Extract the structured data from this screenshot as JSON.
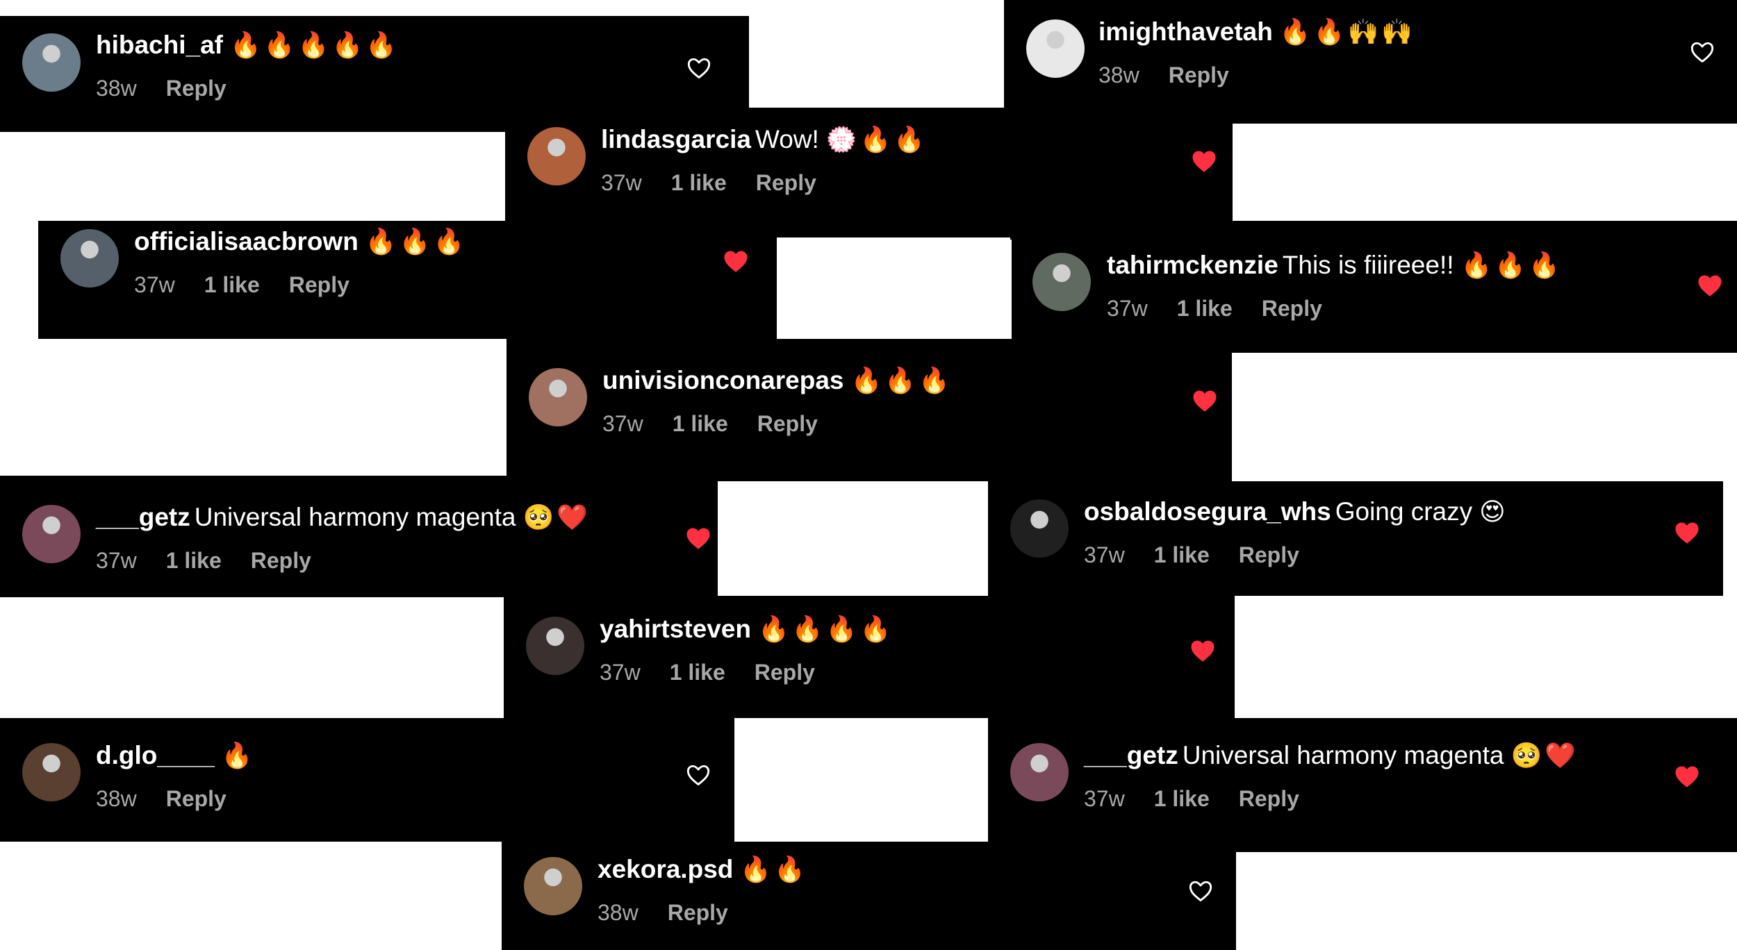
{
  "accent": "#ff3040",
  "comments": [
    {
      "user": "hibachi_af",
      "text": "",
      "emojis": "🔥🔥🔥🔥🔥",
      "age": "38w",
      "likes": "",
      "reply": "Reply",
      "liked": false,
      "avatar": "#6b7d8a"
    },
    {
      "user": "lindasgarcia",
      "text": "Wow!",
      "emojis": "💮🔥🔥",
      "age": "37w",
      "likes": "1 like",
      "reply": "Reply",
      "liked": true,
      "avatar": "#b0603a"
    },
    {
      "user": "officialisaacbrown",
      "text": "",
      "emojis": "🔥🔥🔥",
      "age": "37w",
      "likes": "1 like",
      "reply": "Reply",
      "liked": true,
      "avatar": "#56606a"
    },
    {
      "user": "univisionconarepas",
      "text": "",
      "emojis": "🔥🔥🔥",
      "age": "37w",
      "likes": "1 like",
      "reply": "Reply",
      "liked": true,
      "avatar": "#a07060"
    },
    {
      "user": "___getz",
      "text": "Universal harmony magenta",
      "emojis": "🥺❤️",
      "age": "37w",
      "likes": "1 like",
      "reply": "Reply",
      "liked": true,
      "avatar": "#7a4a5a"
    },
    {
      "user": "yahirtsteven",
      "text": "",
      "emojis": "🔥🔥🔥🔥",
      "age": "37w",
      "likes": "1 like",
      "reply": "Reply",
      "liked": true,
      "avatar": "#3a3030"
    },
    {
      "user": "d.glo____",
      "text": "",
      "emojis": "🔥",
      "age": "38w",
      "likes": "",
      "reply": "Reply",
      "liked": false,
      "avatar": "#5a4030"
    },
    {
      "user": "xekora.psd",
      "text": "",
      "emojis": "🔥🔥",
      "age": "38w",
      "likes": "",
      "reply": "Reply",
      "liked": false,
      "avatar": "#8a6a4a"
    },
    {
      "user": "imighthavetah",
      "text": "",
      "emojis": "🔥🔥🙌🙌",
      "age": "38w",
      "likes": "",
      "reply": "Reply",
      "liked": false,
      "avatar": "#e8e8e8"
    },
    {
      "user": "tahirmckenzie",
      "text": "This is fiiireee!!",
      "emojis": "🔥🔥🔥",
      "age": "37w",
      "likes": "1 like",
      "reply": "Reply",
      "liked": true,
      "avatar": "#606a60"
    },
    {
      "user": "osbaldosegura_whs",
      "text": "Going crazy",
      "emojis": "😍",
      "age": "37w",
      "likes": "1 like",
      "reply": "Reply",
      "liked": true,
      "avatar": "#202020"
    },
    {
      "user": "___getz",
      "text": "Universal harmony magenta",
      "emojis": "🥺❤️",
      "age": "37w",
      "likes": "1 like",
      "reply": "Reply",
      "liked": true,
      "avatar": "#7a4a5a"
    }
  ],
  "stray_hearts": [
    {
      "liked": true
    },
    {
      "liked": true
    },
    {
      "liked": true
    }
  ]
}
